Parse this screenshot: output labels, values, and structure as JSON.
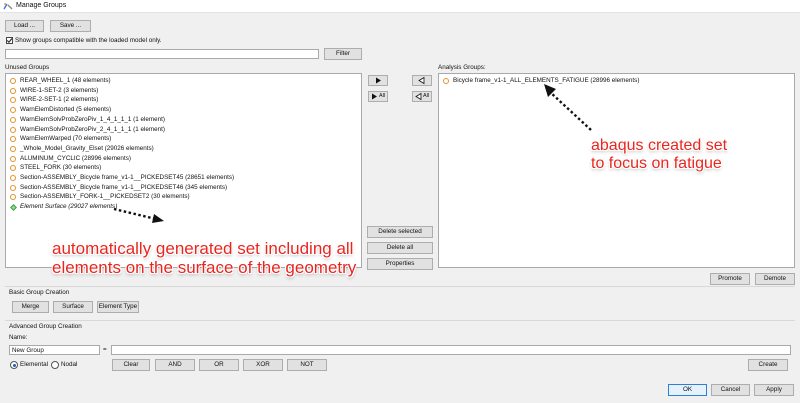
{
  "window": {
    "title": "Manage Groups"
  },
  "toolbar": {
    "load_label": "Load ...",
    "save_label": "Save ..."
  },
  "filter": {
    "compat_checkbox_label": "Show groups compatible with the loaded model only.",
    "compat_checked": true,
    "input_value": "",
    "button_label": "Filter"
  },
  "unused": {
    "title": "Unused Groups",
    "items": [
      {
        "label": "REAR_WHEEL_1 (48 elements)"
      },
      {
        "label": "WIRE-1-SET-2 (3 elements)"
      },
      {
        "label": "WIRE-2-SET-1 (2 elements)"
      },
      {
        "label": "WarnElemDistorted (5 elements)"
      },
      {
        "label": "WarnElemSolvProbZeroPiv_1_4_1_1_1 (1 element)"
      },
      {
        "label": "WarnElemSolvProbZeroPiv_2_4_1_1_1 (1 element)"
      },
      {
        "label": "WarnElemWarped (70 elements)"
      },
      {
        "label": "_Whole_Model_Gravity_Elset (29026 elements)"
      },
      {
        "label": "ALUMINUM_CYCLIC (28996 elements)"
      },
      {
        "label": "STEEL_FORK (30 elements)"
      },
      {
        "label": "Section-ASSEMBLY_Bicycle frame_v1-1__PICKEDSET45 (28651 elements)"
      },
      {
        "label": "Section-ASSEMBLY_Bicycle frame_v1-1__PICKEDSET46 (345 elements)"
      },
      {
        "label": "Section-ASSEMBLY_FORK-1__PICKEDSET2 (30 elements)"
      },
      {
        "label": "Element Surface (29027 elements)"
      }
    ]
  },
  "transfer": {
    "all_right_label": "All",
    "all_left_label": "All",
    "delete_selected_label": "Delete selected",
    "delete_all_label": "Delete all",
    "properties_label": "Properties"
  },
  "analysis": {
    "title": "Analysis Groups:",
    "items": [
      {
        "label": "Bicycle frame_v1-1_ALL_ELEMENTS_FATIGUE (28996 elements)"
      }
    ],
    "promote_label": "Promote",
    "demote_label": "Demote"
  },
  "basic": {
    "title": "Basic Group Creation",
    "merge_label": "Merge",
    "surface_label": "Surface",
    "element_type_label": "Element Type"
  },
  "advanced": {
    "title": "Advanced Group Creation",
    "name_label": "Name:",
    "name_value": "New Group",
    "equals": "=",
    "expression_value": "",
    "radio_elemental": "Elemental",
    "radio_nodal": "Nodal",
    "selected_radio": "Elemental",
    "clear_label": "Clear",
    "and_label": "AND",
    "or_label": "OR",
    "xor_label": "XOR",
    "not_label": "NOT",
    "create_label": "Create"
  },
  "footer": {
    "ok_label": "OK",
    "cancel_label": "Cancel",
    "apply_label": "Apply"
  },
  "annotations": {
    "left_line1": "automatically generated set including all",
    "left_line2": "elements on the surface of the geometry",
    "right_line1": "abaqus created set",
    "right_line2": "to focus on fatigue",
    "color": "#e8261f"
  },
  "colors": {
    "group_icon": "#e8902a",
    "surface_icon": "#3fa33f",
    "accent": "#2f7fd6"
  }
}
